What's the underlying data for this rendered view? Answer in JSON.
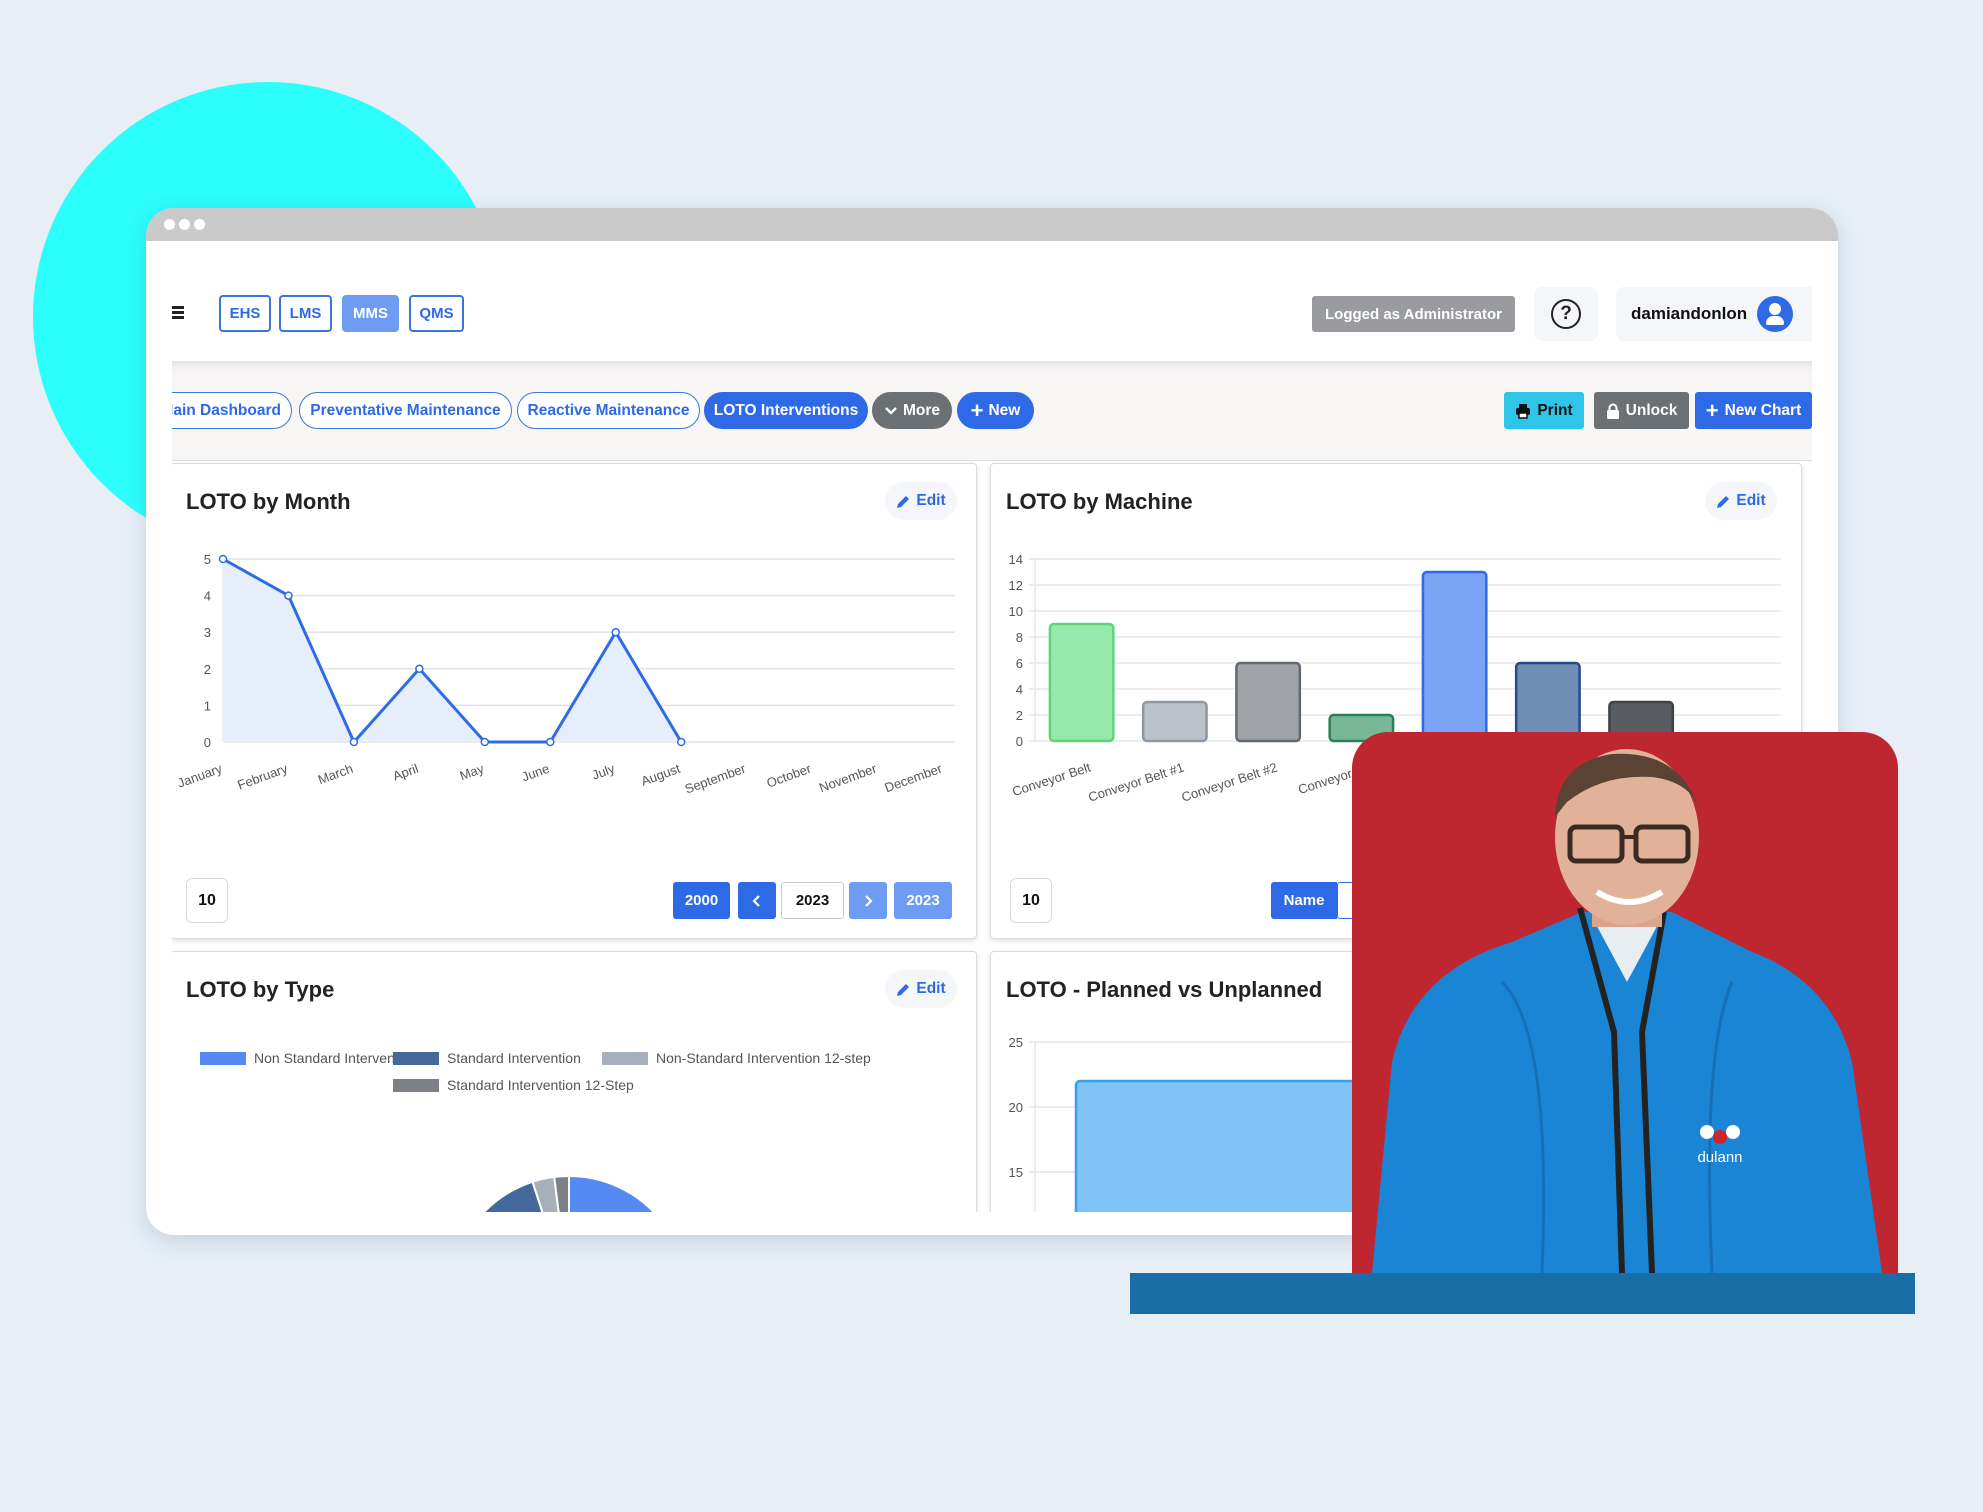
{
  "window": {
    "controls": [
      "dot",
      "dot",
      "dot"
    ]
  },
  "header": {
    "menu_icon": "hamburger-icon",
    "modules": [
      {
        "label": "EHS",
        "active": false
      },
      {
        "label": "LMS",
        "active": false
      },
      {
        "label": "MMS",
        "active": true
      },
      {
        "label": "QMS",
        "active": false
      }
    ],
    "role_badge": "Logged as Administrator",
    "help_icon": "?",
    "username": "damiandonlon",
    "avatar_icon": "user-icon"
  },
  "tabs": {
    "items": [
      {
        "label": "Main Dashboard",
        "active": false
      },
      {
        "label": "Preventative Maintenance",
        "active": false
      },
      {
        "label": "Reactive Maintenance",
        "active": false
      },
      {
        "label": "LOTO Interventions",
        "active": true
      }
    ],
    "more_label": "More",
    "new_label": "New",
    "print_label": "Print",
    "unlock_label": "Unlock",
    "new_chart_label": "New Chart"
  },
  "cards": {
    "edit_label": "Edit",
    "by_month": {
      "title": "LOTO by Month",
      "page_size": "10",
      "year_start": "2000",
      "year_current": "2023",
      "year_end": "2023"
    },
    "by_machine": {
      "title": "LOTO by Machine",
      "page_size": "10",
      "sort_name": "Name"
    },
    "by_type": {
      "title": "LOTO by Type"
    },
    "planned": {
      "title": "LOTO - Planned vs Unplanned"
    }
  },
  "colors": {
    "accent": "#2e6ae6",
    "print": "#2ec5e8",
    "unlock": "#6b7075",
    "photo_bg": "#be272f",
    "strip": "#196fa5",
    "circle": "#2cfefb"
  },
  "chart_data": [
    {
      "id": "by_month",
      "type": "line",
      "title": "LOTO by Month",
      "categories": [
        "January",
        "February",
        "March",
        "April",
        "May",
        "June",
        "July",
        "August",
        "September",
        "October",
        "November",
        "December"
      ],
      "values": [
        5,
        4,
        0,
        2,
        0,
        0,
        3,
        0,
        null,
        null,
        null,
        null
      ],
      "yticks": [
        "0",
        "1",
        "2",
        "3",
        "4",
        "5"
      ],
      "ylim": [
        0,
        5
      ],
      "grid": true,
      "color": "#2f6be4",
      "fill": "#e6eefb"
    },
    {
      "id": "by_machine",
      "type": "bar",
      "title": "LOTO by Machine",
      "categories": [
        "Conveyor Belt",
        "Conveyor Belt #1",
        "Conveyor Belt #2",
        "Conveyor Be",
        "",
        "",
        ""
      ],
      "values": [
        9,
        3,
        6,
        2,
        13,
        6,
        3
      ],
      "fills": [
        "#95e9ab",
        "#bbc2c9",
        "#a0a4a8",
        "#77b898",
        "#7ba5f4",
        "#708eb5",
        "#595c60"
      ],
      "strokes": [
        "#5fd27a",
        "#8f98a1",
        "#626971",
        "#2d7f56",
        "#2e6ae6",
        "#234b8a",
        "#3f4245"
      ],
      "yticks": [
        "0",
        "2",
        "4",
        "6",
        "8",
        "10",
        "12",
        "14"
      ],
      "ylim": [
        0,
        14
      ],
      "grid": true
    },
    {
      "id": "by_type",
      "type": "pie",
      "title": "LOTO by Type",
      "legend": [
        {
          "label": "Non Standard Intervention",
          "color": "#548af2"
        },
        {
          "label": "Standard Intervention",
          "color": "#44689b"
        },
        {
          "label": "Non-Standard Intervention 12-step",
          "color": "#a7b0ba"
        },
        {
          "label": "Standard Intervention 12-Step",
          "color": "#7c8187"
        }
      ],
      "values": [
        50,
        45,
        3,
        2
      ],
      "legend_position": "top"
    },
    {
      "id": "planned",
      "type": "bar",
      "title": "LOTO - Planned vs Unplanned",
      "values": [
        22
      ],
      "yticks": [
        "15",
        "20",
        "25"
      ],
      "ylim_visible": [
        15,
        25
      ],
      "color": "#7fc3f7",
      "stroke": "#3aa0f2",
      "grid": true
    }
  ]
}
